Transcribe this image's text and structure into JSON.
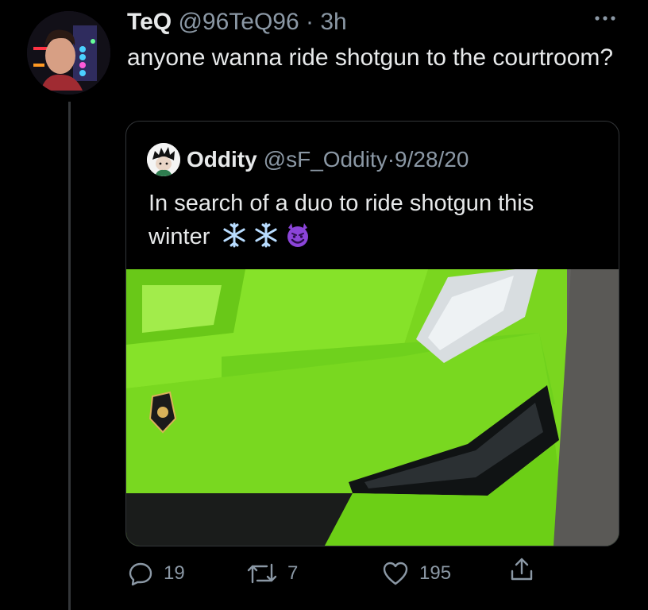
{
  "tweet": {
    "display_name": "TeQ",
    "handle": "@96TeQ96",
    "separator": "·",
    "time": "3h",
    "text": "anyone wanna ride shotgun to the courtroom?"
  },
  "quote": {
    "display_name": "Oddity",
    "handle": "@sF_Oddity",
    "separator": "·",
    "date": "9/28/20",
    "text": "In search of a duo to ride shotgun this winter",
    "emojis": [
      "❄️",
      "❄️",
      "😈"
    ]
  },
  "actions": {
    "reply_count": "19",
    "retweet_count": "7",
    "like_count": "195"
  },
  "icons": {
    "more": "more-horizontal-icon",
    "reply": "reply-icon",
    "retweet": "retweet-icon",
    "like": "heart-icon",
    "share": "share-icon"
  },
  "colors": {
    "background": "#000000",
    "text_primary": "#e7e9ea",
    "text_secondary": "#8b98a5",
    "border": "#333639",
    "car_green": "#7ad61f"
  }
}
